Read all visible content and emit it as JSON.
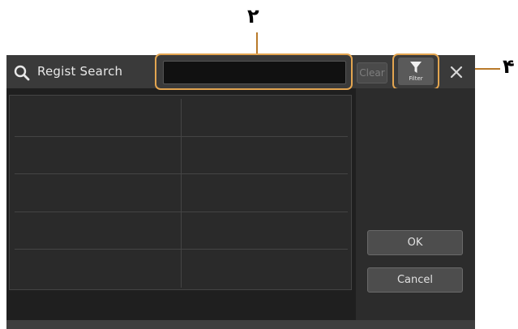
{
  "annotations": {
    "callout_search": "٢",
    "callout_filter": "۴"
  },
  "window": {
    "title": "Regist Search"
  },
  "search": {
    "value": "",
    "placeholder": "",
    "clear_label": "Clear"
  },
  "filter": {
    "label": "Filter"
  },
  "results": {
    "rows": [
      [
        "",
        ""
      ],
      [
        "",
        ""
      ],
      [
        "",
        ""
      ],
      [
        "",
        ""
      ],
      [
        "",
        ""
      ]
    ]
  },
  "actions": {
    "ok_label": "OK",
    "cancel_label": "Cancel"
  },
  "colors": {
    "highlight": "#e3a550",
    "window_bg": "#1f1f1f",
    "titlebar_bg": "#3a3a3a"
  },
  "icons": [
    "search-icon",
    "filter-icon",
    "close-icon"
  ]
}
